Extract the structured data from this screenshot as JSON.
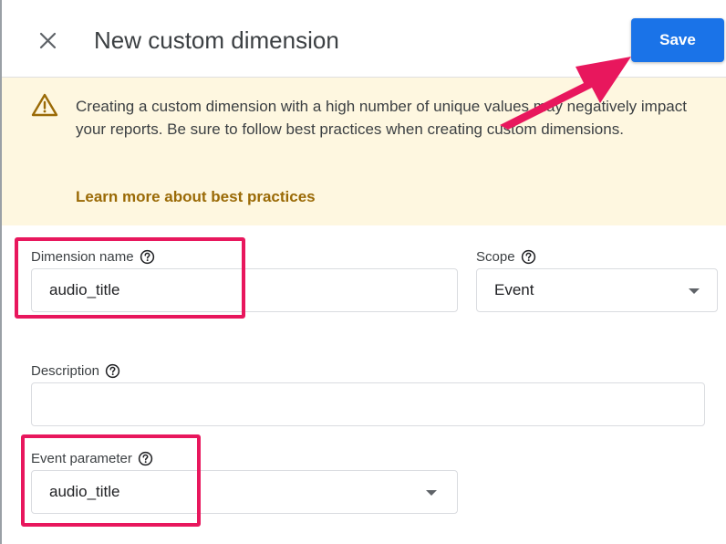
{
  "dialog": {
    "title": "New custom dimension",
    "save_label": "Save"
  },
  "warning": {
    "message": "Creating a custom dimension with a high number of unique values may negatively impact your reports. Be sure to follow best practices when creating custom dimensions.",
    "link_text": "Learn more about best practices"
  },
  "form": {
    "dimension_name": {
      "label": "Dimension name",
      "value": "audio_title"
    },
    "scope": {
      "label": "Scope",
      "selected": "Event"
    },
    "description": {
      "label": "Description",
      "value": ""
    },
    "event_parameter": {
      "label": "Event parameter",
      "selected": "audio_title"
    }
  },
  "icons": {
    "close": "close-icon",
    "warning": "warning-icon",
    "help": "help-icon",
    "dropdown": "chevron-down-icon"
  },
  "colors": {
    "primary": "#1a73e8",
    "warning_bg": "#fef7e0",
    "link": "#9a6a06",
    "annotation": "#e8175d"
  }
}
